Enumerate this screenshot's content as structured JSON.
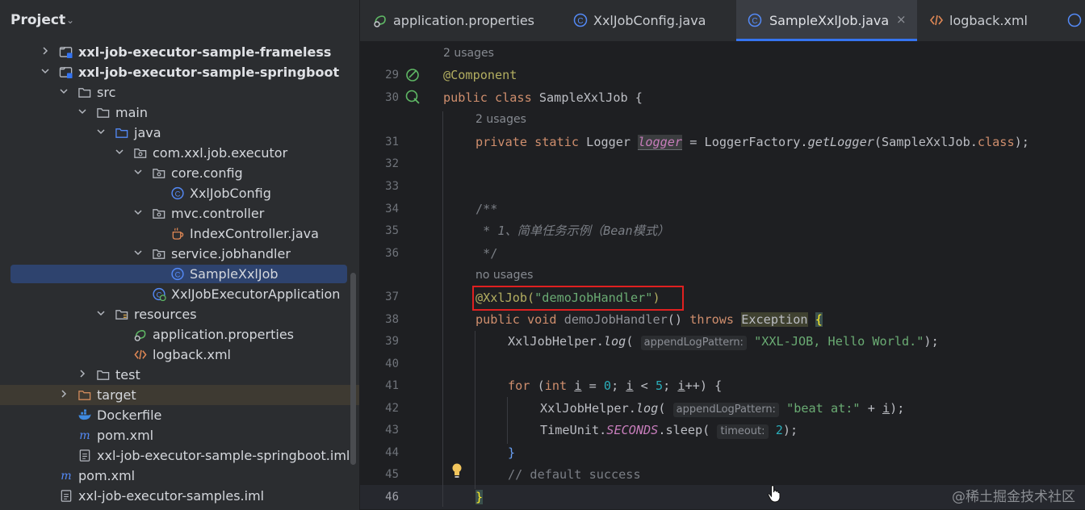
{
  "project": {
    "title": "Project",
    "tree": [
      {
        "label": "xxl-job-executor-sample-frameless",
        "icon": "module-folder-icon",
        "arrow": "collapsed",
        "indent": 0,
        "bold": true
      },
      {
        "label": "xxl-job-executor-sample-springboot",
        "icon": "module-folder-icon",
        "arrow": "expanded",
        "indent": 0,
        "bold": true
      },
      {
        "label": "src",
        "icon": "folder-icon",
        "arrow": "expanded",
        "indent": 1
      },
      {
        "label": "main",
        "icon": "folder-icon",
        "arrow": "expanded",
        "indent": 2
      },
      {
        "label": "java",
        "icon": "source-folder-icon",
        "arrow": "expanded",
        "indent": 3
      },
      {
        "label": "com.xxl.job.executor",
        "icon": "package-icon",
        "arrow": "expanded",
        "indent": 4
      },
      {
        "label": "core.config",
        "icon": "package-icon",
        "arrow": "expanded",
        "indent": 5
      },
      {
        "label": "XxlJobConfig",
        "icon": "class-icon",
        "arrow": "",
        "indent": 6
      },
      {
        "label": "mvc.controller",
        "icon": "package-icon",
        "arrow": "expanded",
        "indent": 5
      },
      {
        "label": "IndexController.java",
        "icon": "java-file-icon",
        "arrow": "",
        "indent": 6
      },
      {
        "label": "service.jobhandler",
        "icon": "package-icon",
        "arrow": "expanded",
        "indent": 5
      },
      {
        "label": "SampleXxlJob",
        "icon": "class-icon",
        "arrow": "",
        "indent": 6,
        "selected": true
      },
      {
        "label": "XxlJobExecutorApplication",
        "icon": "spring-class-icon",
        "arrow": "",
        "indent": 5
      },
      {
        "label": "resources",
        "icon": "resources-folder-icon",
        "arrow": "expanded",
        "indent": 3
      },
      {
        "label": "application.properties",
        "icon": "properties-file-icon",
        "arrow": "",
        "indent": 4
      },
      {
        "label": "logback.xml",
        "icon": "xml-file-icon",
        "arrow": "",
        "indent": 4
      },
      {
        "label": "test",
        "icon": "folder-icon",
        "arrow": "collapsed",
        "indent": 2
      },
      {
        "label": "target",
        "icon": "excluded-folder-icon",
        "arrow": "collapsed",
        "indent": 1,
        "band": true
      },
      {
        "label": "Dockerfile",
        "icon": "docker-icon",
        "arrow": "",
        "indent": 1
      },
      {
        "label": "pom.xml",
        "icon": "maven-icon",
        "arrow": "",
        "indent": 1
      },
      {
        "label": "xxl-job-executor-sample-springboot.iml",
        "icon": "iml-file-icon",
        "arrow": "",
        "indent": 1
      },
      {
        "label": "pom.xml",
        "icon": "maven-icon",
        "arrow": "",
        "indent": 0
      },
      {
        "label": "xxl-job-executor-samples.iml",
        "icon": "iml-file-icon",
        "arrow": "",
        "indent": 0
      }
    ]
  },
  "tabs": [
    {
      "label": "application.properties",
      "icon": "properties-file-icon",
      "active": false
    },
    {
      "label": "XxlJobConfig.java",
      "icon": "class-icon",
      "active": false
    },
    {
      "label": "SampleXxlJob.java",
      "icon": "class-icon",
      "active": true,
      "close": "×"
    },
    {
      "label": "logback.xml",
      "icon": "xml-file-icon",
      "active": false
    }
  ],
  "editor": {
    "hints": {
      "usages_class": "2 usages",
      "usages_field": "2 usages",
      "no_usages": "no usages"
    },
    "line_numbers": [
      "29",
      "30",
      "31",
      "32",
      "33",
      "34",
      "35",
      "36",
      "37",
      "38",
      "39",
      "40",
      "41",
      "42",
      "43",
      "44",
      "45",
      "46"
    ],
    "code": {
      "l29_annotation": "@Component",
      "l30_kw": "public class",
      "l30_name": "SampleXxlJob",
      "l30_brace": "{",
      "l31_kw": "private static",
      "l31_type": "Logger",
      "l31_var": "logger",
      "l31_eq": "=",
      "l31_factory": "LoggerFactory.",
      "l31_method": "getLogger",
      "l31_arg": "(SampleXxlJob.",
      "l31_class": "class",
      "l31_end": ");",
      "l34": "/**",
      "l35": " * 1、简单任务示例（Bean模式）",
      "l36": " */",
      "l37_ann": "@XxlJob(",
      "l37_str": "\"demoJobHandler\"",
      "l37_end": ")",
      "l38_kw": "public void",
      "l38_name": "demoJobHandler",
      "l38_paren": "()",
      "l38_throws": "throws",
      "l38_exc": "Exception",
      "l38_brace": "{",
      "l39_call": "XxlJobHelper.",
      "l39_method": "log",
      "l39_hint": "appendLogPattern:",
      "l39_str": "\"XXL-JOB, Hello World.\"",
      "l39_end": ");",
      "l41_for": "for",
      "l41_int": "int",
      "l41_i": "i",
      "l41_eq": " = ",
      "l41_zero": "0",
      "l41_cond": " < ",
      "l41_five": "5",
      "l41_inc": "++) {",
      "l42_call": "XxlJobHelper.",
      "l42_method": "log",
      "l42_hint": "appendLogPattern:",
      "l42_str": "\"beat at:\"",
      "l42_plus": " + ",
      "l42_end": ");",
      "l43_unit": "TimeUnit.",
      "l43_field": "SECONDS",
      "l43_sleep": ".sleep(",
      "l43_hint": "timeout:",
      "l43_num": "2",
      "l43_end": ");",
      "l44": "}",
      "l45": "// default success",
      "l46": "}"
    }
  },
  "watermark": "@稀土掘金技术社区",
  "colors": {
    "accent": "#3574f0",
    "annotation_box": "#e02020",
    "selection": "#2e436e"
  }
}
